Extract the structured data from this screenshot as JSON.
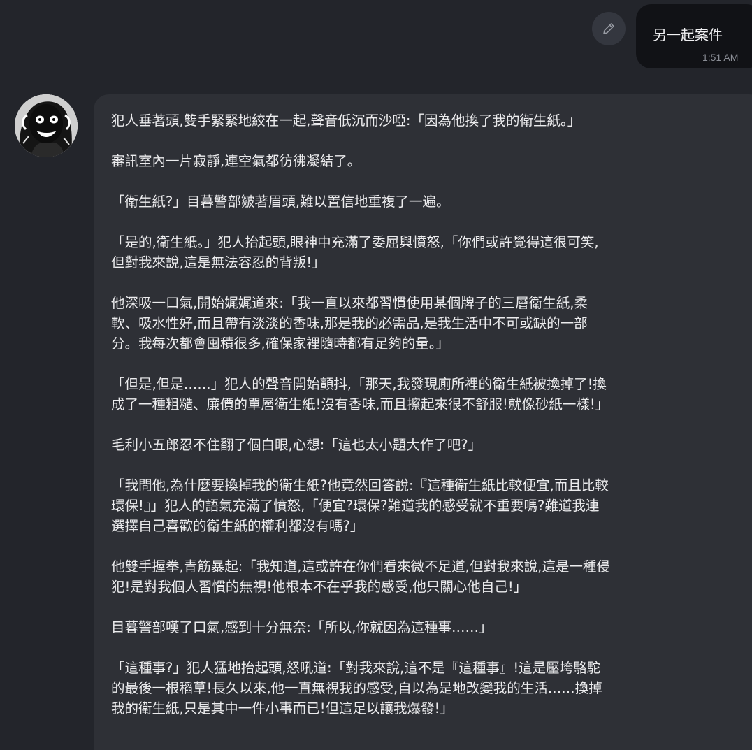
{
  "user_message": {
    "text": "另一起案件",
    "time": "1:51 AM",
    "edit_icon": "pencil-icon"
  },
  "bot_message": {
    "avatar_icon": "avatar-character-face",
    "paragraphs": [
      [
        "犯人垂著頭,雙手緊緊地絞在一起,聲音低沉而沙啞:「因為他換了我的衛生紙。」"
      ],
      [
        "審訊室內一片寂靜,連空氣都彷彿凝結了。"
      ],
      [
        "「衛生紙?」目暮警部皺著眉頭,難以置信地重複了一遍。"
      ],
      [
        "「是的,衛生紙。」犯人抬起頭,眼神中充滿了委屈與憤怒,「你們或許覺得這很可笑,",
        "但對我來說,這是無法容忍的背叛!」"
      ],
      [
        "他深吸一口氣,開始娓娓道來:「我一直以來都習慣使用某個牌子的三層衛生紙,柔",
        "軟、吸水性好,而且帶有淡淡的香味,那是我的必需品,是我生活中不可或缺的一部",
        "分。我每次都會囤積很多,確保家裡隨時都有足夠的量。」"
      ],
      [
        "「但是,但是……」犯人的聲音開始顫抖,「那天,我發現廁所裡的衛生紙被換掉了!換",
        "成了一種粗糙、廉價的單層衛生紙!沒有香味,而且擦起來很不舒服!就像砂紙一樣!」"
      ],
      [
        "毛利小五郎忍不住翻了個白眼,心想:「這也太小題大作了吧?」"
      ],
      [
        "「我問他,為什麼要換掉我的衛生紙?他竟然回答說:『這種衛生紙比較便宜,而且比較",
        "環保!』」犯人的語氣充滿了憤怒,「便宜?環保?難道我的感受就不重要嗎?難道我連",
        "選擇自己喜歡的衛生紙的權利都沒有嗎?」"
      ],
      [
        "他雙手握拳,青筋暴起:「我知道,這或許在你們看來微不足道,但對我來說,這是一種侵",
        "犯!是對我個人習慣的無視!他根本不在乎我的感受,他只關心他自己!」"
      ],
      [
        "目暮警部嘆了口氣,感到十分無奈:「所以,你就因為這種事……」"
      ],
      [
        "「這種事?」犯人猛地抬起頭,怒吼道:「對我來說,這不是『這種事』!這是壓垮駱駝",
        "的最後一根稻草!長久以來,他一直無視我的感受,自以為是地改變我的生活……換掉",
        "我的衛生紙,只是其中一件小事而已!但這足以讓我爆發!」"
      ]
    ]
  },
  "colors": {
    "background": "#23252b",
    "user_bubble": "#111216",
    "bot_bubble": "#2e3036",
    "text": "#ececee",
    "timestamp": "#8a8d95"
  }
}
